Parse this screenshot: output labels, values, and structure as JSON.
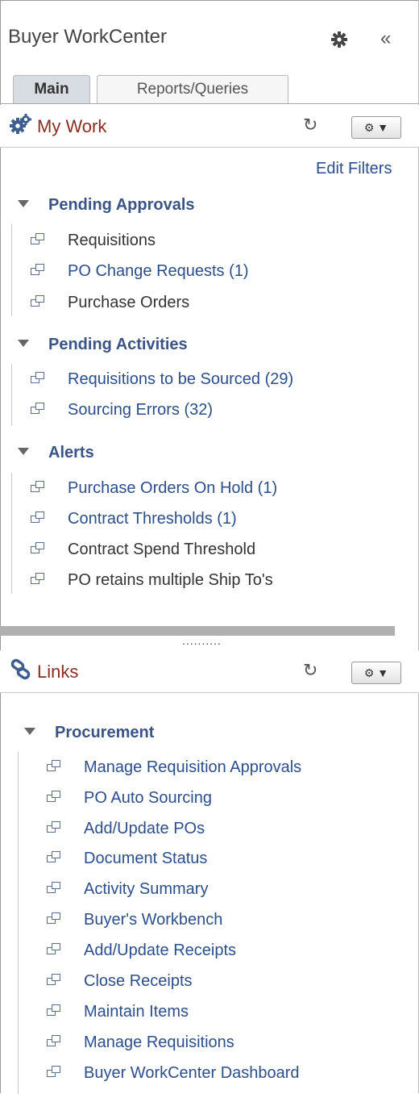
{
  "header": {
    "title": "Buyer WorkCenter",
    "collapse_glyph": "«"
  },
  "tabs": [
    {
      "label": "Main"
    },
    {
      "label": "Reports/Queries"
    }
  ],
  "my_work": {
    "title": "My Work",
    "edit_filters": "Edit Filters",
    "sections": [
      {
        "title": "Pending Approvals",
        "items": [
          "Requisitions",
          "PO Change Requests (1)",
          "Purchase Orders"
        ]
      },
      {
        "title": "Pending Activities",
        "items": [
          "Requisitions to be Sourced (29)",
          "Sourcing Errors (32)"
        ]
      },
      {
        "title": "Alerts",
        "items": [
          "Purchase Orders On Hold (1)",
          "Contract Thresholds (1)",
          "Contract Spend Threshold",
          "PO retains multiple Ship To's"
        ]
      }
    ]
  },
  "links": {
    "title": "Links",
    "sections": [
      {
        "title": "Procurement",
        "items": [
          "Manage Requisition Approvals",
          "PO Auto Sourcing",
          "Add/Update POs",
          "Document Status",
          "Activity Summary",
          "Buyer's Workbench",
          "Add/Update Receipts",
          "Close Receipts",
          "Maintain Items",
          "Manage Requisitions",
          "Buyer WorkCenter Dashboard"
        ]
      }
    ]
  },
  "splitter_dots": "..........",
  "colors": {
    "link": "#2b4f8c",
    "pagelet_title": "#8b2d20",
    "section_heading": "#3a5487"
  },
  "icons": [
    "gear-icon",
    "collapse-icon",
    "my-work-gears-icon",
    "refresh-icon",
    "actions-gear-icon",
    "links-icon",
    "expand-triangle-icon",
    "link-page-icon"
  ]
}
